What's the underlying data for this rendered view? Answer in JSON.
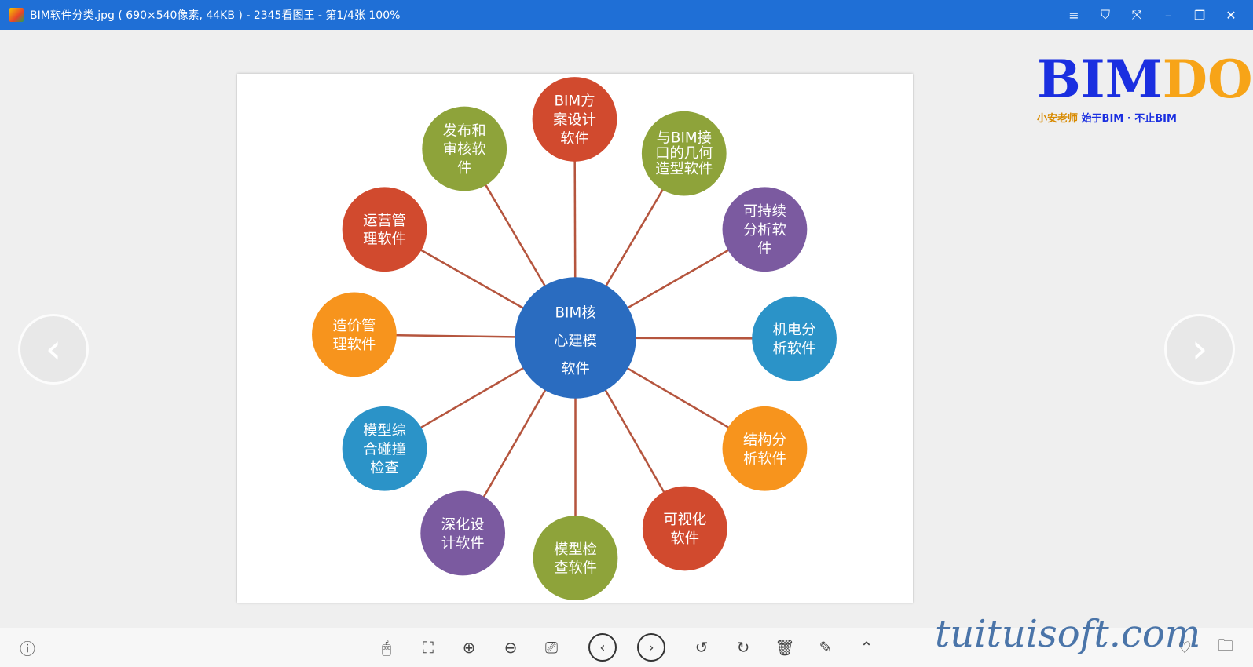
{
  "window": {
    "title": "BIM软件分类.jpg ( 690×540像素, 44KB ) - 2345看图王 - 第1/4张 100%",
    "controls": [
      "≡",
      "⛉",
      "⤧",
      "–",
      "❐",
      "✕"
    ]
  },
  "diagram": {
    "center": {
      "lines": [
        "BIM核",
        "心建模",
        "软件"
      ],
      "color": "#2a6cc0"
    },
    "nodes": [
      {
        "lines": [
          "BIM方",
          "案设计",
          "软件"
        ],
        "color": "#d14a2e"
      },
      {
        "lines": [
          "与BIM接",
          "口的几何",
          "造型软件"
        ],
        "color": "#8ea33a"
      },
      {
        "lines": [
          "可持续",
          "分析软",
          "件"
        ],
        "color": "#7b5aa0"
      },
      {
        "lines": [
          "机电分",
          "析软件"
        ],
        "color": "#2b93c8"
      },
      {
        "lines": [
          "结构分",
          "析软件"
        ],
        "color": "#f7941d"
      },
      {
        "lines": [
          "可视化",
          "软件"
        ],
        "color": "#d14a2e"
      },
      {
        "lines": [
          "模型检",
          "查软件"
        ],
        "color": "#8ea33a"
      },
      {
        "lines": [
          "深化设",
          "计软件"
        ],
        "color": "#7b5aa0"
      },
      {
        "lines": [
          "模型综",
          "合碰撞",
          "检查"
        ],
        "color": "#2b93c8"
      },
      {
        "lines": [
          "造价管",
          "理软件"
        ],
        "color": "#f7941d"
      },
      {
        "lines": [
          "运营管",
          "理软件"
        ],
        "color": "#d14a2e"
      },
      {
        "lines": [
          "发布和",
          "审核软",
          "件"
        ],
        "color": "#8ea33a"
      }
    ]
  },
  "logo": {
    "text": "BIMDOG",
    "sub_left": "小安老师",
    "sub_right": "始于BIM · 不止BIM"
  },
  "watermark": "tuituisoft.com",
  "nav": {
    "prev": "‹",
    "next": "›"
  },
  "toolbar": {
    "info": "ⓘ",
    "items": [
      "🖱",
      "⛶",
      "⊕",
      "⊖",
      "⎚",
      "‹",
      "›",
      "↺",
      "↻",
      "🗑",
      "✎",
      "⌃",
      "♡",
      "🗀"
    ]
  }
}
